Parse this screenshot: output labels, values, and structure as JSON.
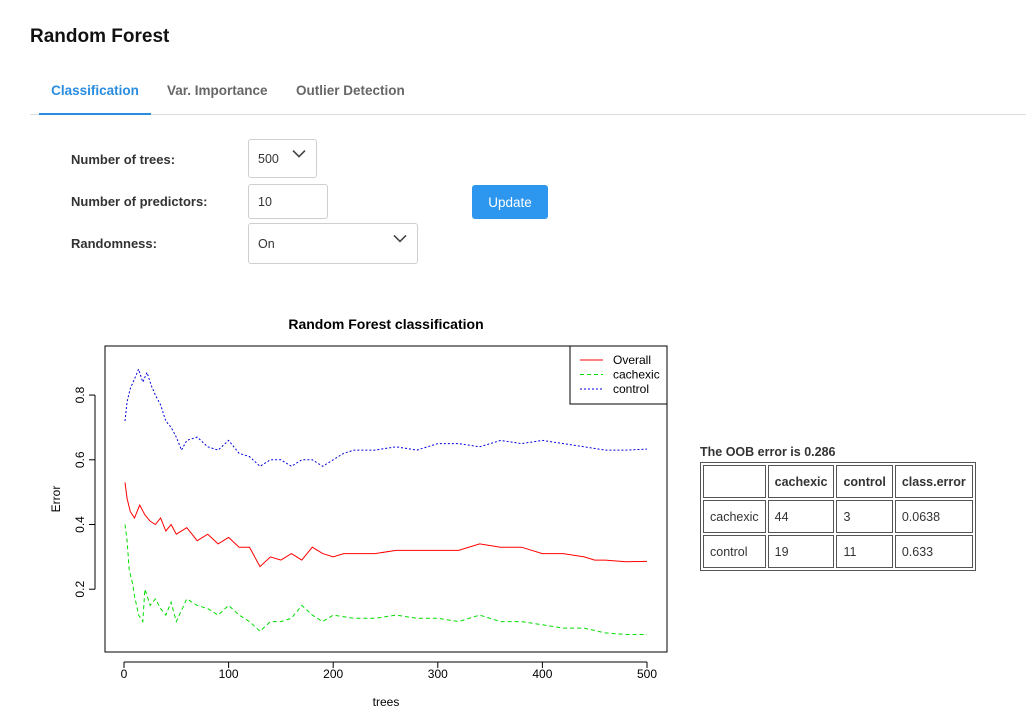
{
  "page": {
    "title": "Random Forest"
  },
  "tabs": [
    {
      "label": "Classification",
      "active": true
    },
    {
      "label": "Var. Importance",
      "active": false
    },
    {
      "label": "Outlier Detection",
      "active": false
    }
  ],
  "form": {
    "trees_label": "Number of trees:",
    "trees_value": "500",
    "predictors_label": "Number of predictors:",
    "predictors_value": "10",
    "randomness_label": "Randomness:",
    "randomness_value": "On",
    "update_label": "Update",
    "accent_color": "#2d97f0"
  },
  "chart_data": {
    "type": "line",
    "title": "Random Forest classification",
    "xlabel": "trees",
    "ylabel": "Error",
    "xlim": [
      0,
      500
    ],
    "ylim": [
      0.04,
      0.93
    ],
    "xticks": [
      0,
      100,
      200,
      300,
      400,
      500
    ],
    "yticks": [
      0.2,
      0.4,
      0.6,
      0.8
    ],
    "legend_position": "top-right",
    "series": [
      {
        "name": "Overall",
        "color": "#ff0000",
        "style": "solid",
        "x": [
          1,
          3,
          6,
          10,
          15,
          20,
          25,
          30,
          35,
          40,
          45,
          50,
          60,
          70,
          80,
          90,
          100,
          110,
          120,
          130,
          140,
          150,
          160,
          170,
          180,
          190,
          200,
          210,
          220,
          240,
          260,
          280,
          300,
          320,
          340,
          360,
          380,
          400,
          420,
          440,
          450,
          460,
          480,
          500
        ],
        "y": [
          0.53,
          0.48,
          0.44,
          0.42,
          0.46,
          0.43,
          0.41,
          0.4,
          0.42,
          0.38,
          0.4,
          0.37,
          0.39,
          0.35,
          0.37,
          0.34,
          0.36,
          0.33,
          0.33,
          0.27,
          0.3,
          0.29,
          0.31,
          0.29,
          0.33,
          0.31,
          0.3,
          0.31,
          0.31,
          0.31,
          0.32,
          0.32,
          0.32,
          0.32,
          0.34,
          0.33,
          0.33,
          0.31,
          0.31,
          0.3,
          0.29,
          0.29,
          0.285,
          0.286
        ]
      },
      {
        "name": "cachexic",
        "color": "#00dd00",
        "style": "dashed",
        "x": [
          1,
          3,
          5,
          8,
          10,
          14,
          18,
          20,
          25,
          30,
          35,
          40,
          45,
          50,
          60,
          70,
          80,
          90,
          100,
          110,
          120,
          130,
          140,
          150,
          160,
          170,
          180,
          190,
          200,
          220,
          240,
          260,
          280,
          300,
          320,
          340,
          360,
          380,
          400,
          420,
          440,
          460,
          480,
          500
        ],
        "y": [
          0.4,
          0.35,
          0.26,
          0.22,
          0.18,
          0.12,
          0.1,
          0.2,
          0.15,
          0.17,
          0.14,
          0.12,
          0.16,
          0.1,
          0.17,
          0.15,
          0.14,
          0.12,
          0.15,
          0.12,
          0.1,
          0.07,
          0.1,
          0.1,
          0.11,
          0.15,
          0.12,
          0.1,
          0.12,
          0.11,
          0.11,
          0.12,
          0.11,
          0.11,
          0.1,
          0.12,
          0.1,
          0.1,
          0.09,
          0.08,
          0.08,
          0.065,
          0.06,
          0.06
        ]
      },
      {
        "name": "control",
        "color": "#0000dd",
        "style": "dotted",
        "x": [
          1,
          3,
          6,
          10,
          14,
          18,
          22,
          26,
          30,
          35,
          40,
          45,
          50,
          55,
          60,
          70,
          80,
          90,
          100,
          110,
          120,
          130,
          140,
          150,
          160,
          170,
          180,
          190,
          200,
          210,
          220,
          240,
          260,
          280,
          300,
          320,
          340,
          360,
          380,
          400,
          420,
          440,
          460,
          480,
          500
        ],
        "y": [
          0.72,
          0.78,
          0.82,
          0.85,
          0.88,
          0.84,
          0.87,
          0.83,
          0.8,
          0.77,
          0.72,
          0.7,
          0.67,
          0.63,
          0.66,
          0.67,
          0.64,
          0.63,
          0.66,
          0.62,
          0.61,
          0.58,
          0.6,
          0.6,
          0.58,
          0.6,
          0.6,
          0.58,
          0.6,
          0.62,
          0.63,
          0.63,
          0.64,
          0.63,
          0.65,
          0.65,
          0.64,
          0.66,
          0.65,
          0.66,
          0.65,
          0.64,
          0.63,
          0.63,
          0.633
        ]
      }
    ]
  },
  "results": {
    "oob_text": "The OOB error is 0.286",
    "columns": [
      "",
      "cachexic",
      "control",
      "class.error"
    ],
    "rows": [
      [
        "cachexic",
        "44",
        "3",
        "0.0638"
      ],
      [
        "control",
        "19",
        "11",
        "0.633"
      ]
    ]
  }
}
